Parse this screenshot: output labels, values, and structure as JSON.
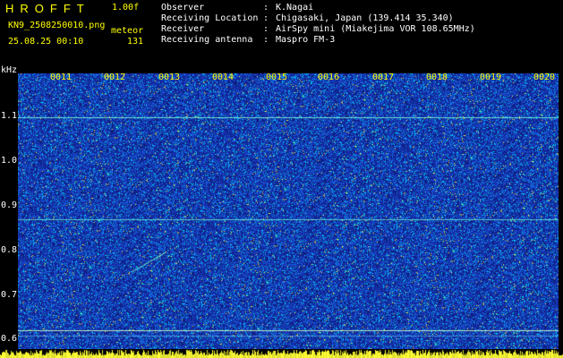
{
  "header": {
    "title": "HROFFT",
    "version": "1.00f",
    "filename": "KN9_2508250010.png",
    "datetime": "25.08.25 00:10",
    "mode": "meteor",
    "count": "131"
  },
  "info": [
    {
      "label": "Observer",
      "sep": ":",
      "value": "K.Nagai"
    },
    {
      "label": "Receiving Location",
      "sep": ":",
      "value": "Chigasaki, Japan (139.414 35.340)"
    },
    {
      "label": "Receiver",
      "sep": ":",
      "value": "AirSpy mini (Miakejima VOR 108.65MHz)"
    },
    {
      "label": "Receiving antenna",
      "sep": ":",
      "value": "Maspro FM-3"
    }
  ],
  "spectrogram": {
    "y_unit": "kHz",
    "x_labels": [
      "0011",
      "0012",
      "0013",
      "0014",
      "0015",
      "0016",
      "0017",
      "0018",
      "0019",
      "0020"
    ],
    "y_labels": [
      "1.1",
      "1.0",
      "0.9",
      "0.8",
      "0.7",
      "0.6"
    ],
    "colors": {
      "background": "#1a2a8f",
      "signal": "#00e0ff",
      "label_yellow": "#ffff00"
    }
  }
}
